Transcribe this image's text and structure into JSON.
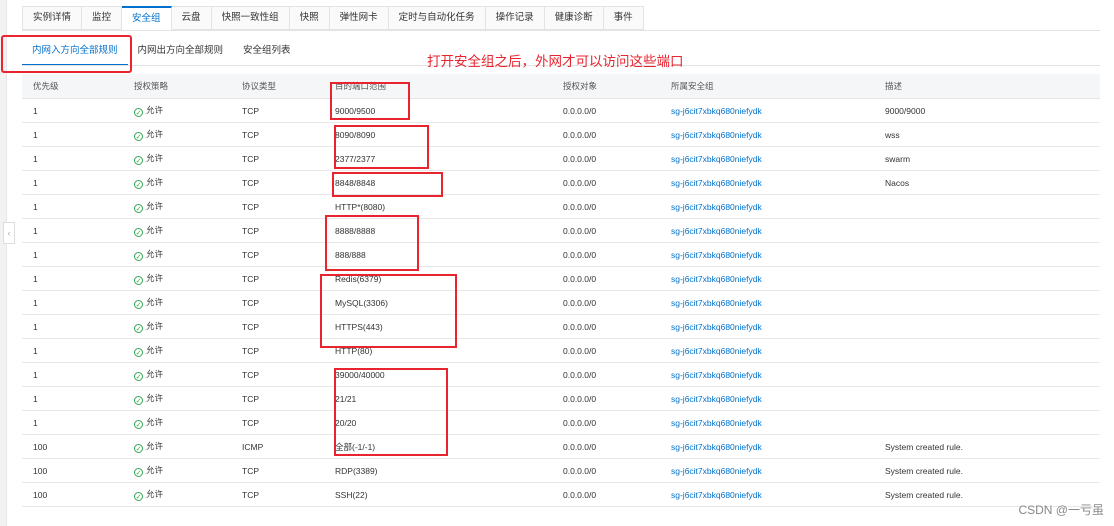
{
  "top_tabs": [
    {
      "label": "实例详情",
      "active": false
    },
    {
      "label": "监控",
      "active": false
    },
    {
      "label": "安全组",
      "active": true
    },
    {
      "label": "云盘",
      "active": false
    },
    {
      "label": "快照一致性组",
      "active": false
    },
    {
      "label": "快照",
      "active": false
    },
    {
      "label": "弹性网卡",
      "active": false
    },
    {
      "label": "定时与自动化任务",
      "active": false
    },
    {
      "label": "操作记录",
      "active": false
    },
    {
      "label": "健康诊断",
      "active": false
    },
    {
      "label": "事件",
      "active": false
    }
  ],
  "sub_tabs": [
    {
      "label": "内网入方向全部规则",
      "active": true
    },
    {
      "label": "内网出方向全部规则",
      "active": false
    },
    {
      "label": "安全组列表",
      "active": false
    }
  ],
  "annotation": "打开安全组之后，外网才可以访问这些端口",
  "table": {
    "headers": {
      "priority": "优先级",
      "policy": "授权策略",
      "protocol": "协议类型",
      "port_range": "目的端口范围",
      "source": "授权对象",
      "group": "所属安全组",
      "description": "描述"
    },
    "rows": [
      {
        "priority": "1",
        "policy": "允许",
        "protocol": "TCP",
        "port_range": "9000/9500",
        "source": "0.0.0.0/0",
        "group": "sg-j6cit7xbkq680niefydk",
        "description": "9000/9000"
      },
      {
        "priority": "1",
        "policy": "允许",
        "protocol": "TCP",
        "port_range": "8090/8090",
        "source": "0.0.0.0/0",
        "group": "sg-j6cit7xbkq680niefydk",
        "description": "wss"
      },
      {
        "priority": "1",
        "policy": "允许",
        "protocol": "TCP",
        "port_range": "2377/2377",
        "source": "0.0.0.0/0",
        "group": "sg-j6cit7xbkq680niefydk",
        "description": "swarm"
      },
      {
        "priority": "1",
        "policy": "允许",
        "protocol": "TCP",
        "port_range": "8848/8848",
        "source": "0.0.0.0/0",
        "group": "sg-j6cit7xbkq680niefydk",
        "description": "Nacos"
      },
      {
        "priority": "1",
        "policy": "允许",
        "protocol": "TCP",
        "port_range": "HTTP*(8080)",
        "source": "0.0.0.0/0",
        "group": "sg-j6cit7xbkq680niefydk",
        "description": ""
      },
      {
        "priority": "1",
        "policy": "允许",
        "protocol": "TCP",
        "port_range": "8888/8888",
        "source": "0.0.0.0/0",
        "group": "sg-j6cit7xbkq680niefydk",
        "description": ""
      },
      {
        "priority": "1",
        "policy": "允许",
        "protocol": "TCP",
        "port_range": "888/888",
        "source": "0.0.0.0/0",
        "group": "sg-j6cit7xbkq680niefydk",
        "description": ""
      },
      {
        "priority": "1",
        "policy": "允许",
        "protocol": "TCP",
        "port_range": "Redis(6379)",
        "source": "0.0.0.0/0",
        "group": "sg-j6cit7xbkq680niefydk",
        "description": ""
      },
      {
        "priority": "1",
        "policy": "允许",
        "protocol": "TCP",
        "port_range": "MySQL(3306)",
        "source": "0.0.0.0/0",
        "group": "sg-j6cit7xbkq680niefydk",
        "description": ""
      },
      {
        "priority": "1",
        "policy": "允许",
        "protocol": "TCP",
        "port_range": "HTTPS(443)",
        "source": "0.0.0.0/0",
        "group": "sg-j6cit7xbkq680niefydk",
        "description": ""
      },
      {
        "priority": "1",
        "policy": "允许",
        "protocol": "TCP",
        "port_range": "HTTP(80)",
        "source": "0.0.0.0/0",
        "group": "sg-j6cit7xbkq680niefydk",
        "description": ""
      },
      {
        "priority": "1",
        "policy": "允许",
        "protocol": "TCP",
        "port_range": "39000/40000",
        "source": "0.0.0.0/0",
        "group": "sg-j6cit7xbkq680niefydk",
        "description": ""
      },
      {
        "priority": "1",
        "policy": "允许",
        "protocol": "TCP",
        "port_range": "21/21",
        "source": "0.0.0.0/0",
        "group": "sg-j6cit7xbkq680niefydk",
        "description": ""
      },
      {
        "priority": "1",
        "policy": "允许",
        "protocol": "TCP",
        "port_range": "20/20",
        "source": "0.0.0.0/0",
        "group": "sg-j6cit7xbkq680niefydk",
        "description": ""
      },
      {
        "priority": "100",
        "policy": "允许",
        "protocol": "ICMP",
        "port_range": "全部(-1/-1)",
        "source": "0.0.0.0/0",
        "group": "sg-j6cit7xbkq680niefydk",
        "description": "System created rule."
      },
      {
        "priority": "100",
        "policy": "允许",
        "protocol": "TCP",
        "port_range": "RDP(3389)",
        "source": "0.0.0.0/0",
        "group": "sg-j6cit7xbkq680niefydk",
        "description": "System created rule."
      },
      {
        "priority": "100",
        "policy": "允许",
        "protocol": "TCP",
        "port_range": "SSH(22)",
        "source": "0.0.0.0/0",
        "group": "sg-j6cit7xbkq680niefydk",
        "description": "System created rule."
      }
    ]
  },
  "watermark": "CSDN @一亏虽",
  "colors": {
    "accent": "#0070cc",
    "annotation": "#e8242f",
    "allow": "#34a853"
  }
}
